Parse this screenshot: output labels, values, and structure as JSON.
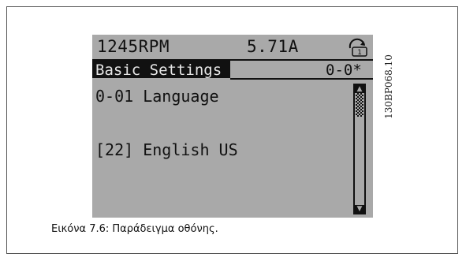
{
  "display": {
    "status_rpm": "1245RPM",
    "status_current": "5.71A",
    "setup_icon": "setup-1-icon",
    "menu_title": "Basic Settings",
    "menu_index": "0-0*",
    "parameter_name": "0-01 Language",
    "parameter_value": "[22] English US",
    "scrollbar_icons": [
      "scroll-up-icon",
      "scroll-down-icon"
    ]
  },
  "figure_id": "130BP068.10",
  "caption": "Εικόνα 7.6: Παράδειγμα οθόνης.",
  "colors": {
    "lcd_background": "#a9a9a9",
    "lcd_text": "#111111",
    "page_background": "#ffffff"
  }
}
